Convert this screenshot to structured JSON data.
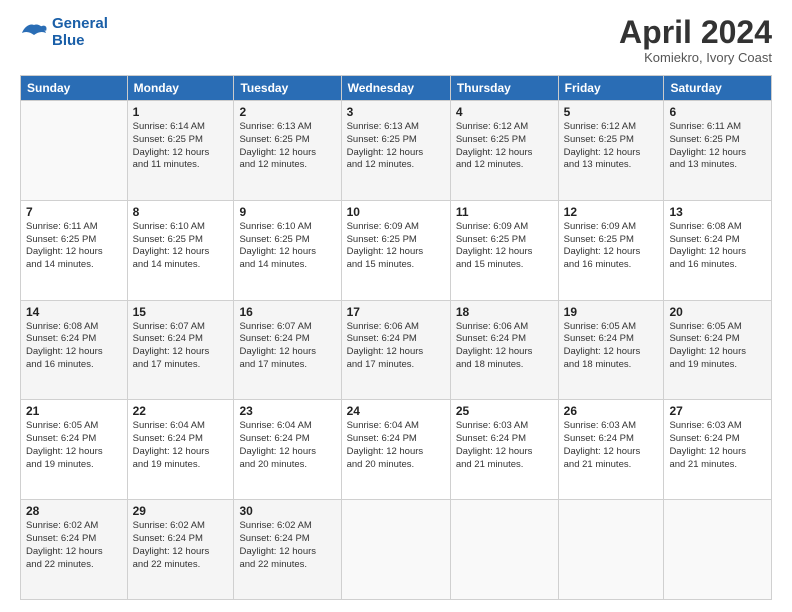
{
  "header": {
    "logo_line1": "General",
    "logo_line2": "Blue",
    "month_title": "April 2024",
    "subtitle": "Komiekro, Ivory Coast"
  },
  "weekdays": [
    "Sunday",
    "Monday",
    "Tuesday",
    "Wednesday",
    "Thursday",
    "Friday",
    "Saturday"
  ],
  "weeks": [
    [
      {
        "day": "",
        "info": ""
      },
      {
        "day": "1",
        "info": "Sunrise: 6:14 AM\nSunset: 6:25 PM\nDaylight: 12 hours\nand 11 minutes."
      },
      {
        "day": "2",
        "info": "Sunrise: 6:13 AM\nSunset: 6:25 PM\nDaylight: 12 hours\nand 12 minutes."
      },
      {
        "day": "3",
        "info": "Sunrise: 6:13 AM\nSunset: 6:25 PM\nDaylight: 12 hours\nand 12 minutes."
      },
      {
        "day": "4",
        "info": "Sunrise: 6:12 AM\nSunset: 6:25 PM\nDaylight: 12 hours\nand 12 minutes."
      },
      {
        "day": "5",
        "info": "Sunrise: 6:12 AM\nSunset: 6:25 PM\nDaylight: 12 hours\nand 13 minutes."
      },
      {
        "day": "6",
        "info": "Sunrise: 6:11 AM\nSunset: 6:25 PM\nDaylight: 12 hours\nand 13 minutes."
      }
    ],
    [
      {
        "day": "7",
        "info": "Sunrise: 6:11 AM\nSunset: 6:25 PM\nDaylight: 12 hours\nand 14 minutes."
      },
      {
        "day": "8",
        "info": "Sunrise: 6:10 AM\nSunset: 6:25 PM\nDaylight: 12 hours\nand 14 minutes."
      },
      {
        "day": "9",
        "info": "Sunrise: 6:10 AM\nSunset: 6:25 PM\nDaylight: 12 hours\nand 14 minutes."
      },
      {
        "day": "10",
        "info": "Sunrise: 6:09 AM\nSunset: 6:25 PM\nDaylight: 12 hours\nand 15 minutes."
      },
      {
        "day": "11",
        "info": "Sunrise: 6:09 AM\nSunset: 6:25 PM\nDaylight: 12 hours\nand 15 minutes."
      },
      {
        "day": "12",
        "info": "Sunrise: 6:09 AM\nSunset: 6:25 PM\nDaylight: 12 hours\nand 16 minutes."
      },
      {
        "day": "13",
        "info": "Sunrise: 6:08 AM\nSunset: 6:24 PM\nDaylight: 12 hours\nand 16 minutes."
      }
    ],
    [
      {
        "day": "14",
        "info": "Sunrise: 6:08 AM\nSunset: 6:24 PM\nDaylight: 12 hours\nand 16 minutes."
      },
      {
        "day": "15",
        "info": "Sunrise: 6:07 AM\nSunset: 6:24 PM\nDaylight: 12 hours\nand 17 minutes."
      },
      {
        "day": "16",
        "info": "Sunrise: 6:07 AM\nSunset: 6:24 PM\nDaylight: 12 hours\nand 17 minutes."
      },
      {
        "day": "17",
        "info": "Sunrise: 6:06 AM\nSunset: 6:24 PM\nDaylight: 12 hours\nand 17 minutes."
      },
      {
        "day": "18",
        "info": "Sunrise: 6:06 AM\nSunset: 6:24 PM\nDaylight: 12 hours\nand 18 minutes."
      },
      {
        "day": "19",
        "info": "Sunrise: 6:05 AM\nSunset: 6:24 PM\nDaylight: 12 hours\nand 18 minutes."
      },
      {
        "day": "20",
        "info": "Sunrise: 6:05 AM\nSunset: 6:24 PM\nDaylight: 12 hours\nand 19 minutes."
      }
    ],
    [
      {
        "day": "21",
        "info": "Sunrise: 6:05 AM\nSunset: 6:24 PM\nDaylight: 12 hours\nand 19 minutes."
      },
      {
        "day": "22",
        "info": "Sunrise: 6:04 AM\nSunset: 6:24 PM\nDaylight: 12 hours\nand 19 minutes."
      },
      {
        "day": "23",
        "info": "Sunrise: 6:04 AM\nSunset: 6:24 PM\nDaylight: 12 hours\nand 20 minutes."
      },
      {
        "day": "24",
        "info": "Sunrise: 6:04 AM\nSunset: 6:24 PM\nDaylight: 12 hours\nand 20 minutes."
      },
      {
        "day": "25",
        "info": "Sunrise: 6:03 AM\nSunset: 6:24 PM\nDaylight: 12 hours\nand 21 minutes."
      },
      {
        "day": "26",
        "info": "Sunrise: 6:03 AM\nSunset: 6:24 PM\nDaylight: 12 hours\nand 21 minutes."
      },
      {
        "day": "27",
        "info": "Sunrise: 6:03 AM\nSunset: 6:24 PM\nDaylight: 12 hours\nand 21 minutes."
      }
    ],
    [
      {
        "day": "28",
        "info": "Sunrise: 6:02 AM\nSunset: 6:24 PM\nDaylight: 12 hours\nand 22 minutes."
      },
      {
        "day": "29",
        "info": "Sunrise: 6:02 AM\nSunset: 6:24 PM\nDaylight: 12 hours\nand 22 minutes."
      },
      {
        "day": "30",
        "info": "Sunrise: 6:02 AM\nSunset: 6:24 PM\nDaylight: 12 hours\nand 22 minutes."
      },
      {
        "day": "",
        "info": ""
      },
      {
        "day": "",
        "info": ""
      },
      {
        "day": "",
        "info": ""
      },
      {
        "day": "",
        "info": ""
      }
    ]
  ]
}
